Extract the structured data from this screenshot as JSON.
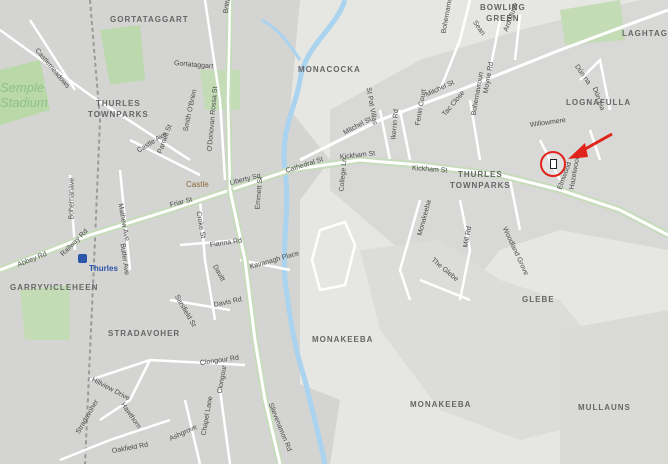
{
  "areas": {
    "gortataggart": "GORTATAGGART",
    "bowling_green": "BOWLING\nGREEN",
    "laghtagalla": "LAGHTAGA",
    "monacocka": "MONACOCKA",
    "lognafulla": "LOGNAFULLA",
    "thurles_townparks_w": "THURLES\nTOWNPARKS",
    "thurles_townparks_e": "THURLES\nTOWNPARKS",
    "garryvicleheen": "GARRYVICLEHEEN",
    "glebe": "GLEBE",
    "stradavoher": "STRADAVOHER",
    "monakeeba_1": "MONAKEEBA",
    "monakeeba_2": "MONAKEEBA",
    "mullauns": "MULLAUNS"
  },
  "places": {
    "semple_stadium": "Semple\nStadium",
    "castle": "Castle",
    "thurles_station": "Thurles"
  },
  "roads": {
    "gortataggart": "Gortataggart",
    "castlemeadows": "Castlemeadows",
    "brittas": "Brittas",
    "smith_obrien": "Smith O'Brien",
    "o_donovan_rossa": "O'Donovan Rossa St",
    "parnell": "Parnell St",
    "castle_ave": "Castle Ave",
    "bohernanave": "Bohernanave",
    "mathew_ave": "Mathew Ave",
    "liberty_sq": "Liberty Sq",
    "cathedral": "Cathedral St",
    "friar": "Friar St",
    "croke": "Croke St",
    "railway": "Railway Rd",
    "abbey": "Abbey Rd",
    "butler_ave": "Butler Ave",
    "fianna": "Fianna Rd",
    "emmett": "Emmett St",
    "kavanagh": "Kavanagh Place",
    "davitt": "Davitt",
    "sarsfield": "Sarsfield St",
    "davis": "Davis Rd",
    "clongour_rd": "Clongour Rd",
    "clongour": "Clongour",
    "hillview": "Hillview Drive",
    "hawthorn": "Hawthorn",
    "oakfield": "Oakfield Rd",
    "stradavoher": "Stradavoher",
    "ashgrove": "Ashgrove",
    "chapel": "Chapel Lane",
    "sievenamon": "Slievenamon Rd",
    "mitchel_a": "Mitchel St",
    "mitchel_b": "Mitchel St",
    "kickham_a": "Kickham St",
    "kickham_b": "Kickham St",
    "college_ln": "College Ln",
    "bohernamona": "Bohernamona",
    "ard_muire": "Ard Muire",
    "moyne": "Moyne Rd",
    "sean": "Sean",
    "dun_na": "Dún na",
    "dun_lia": "Dún Lia",
    "willowmere": "Willowmere",
    "elmwood": "Elmwood",
    "hazelwood": "Hazelwood",
    "st_patrick": "St Pat Villas",
    "tac_close": "Tac Close",
    "fenin_court": "Fenin Court",
    "ikerrin": "Ikerrin Rd",
    "monakeeba": "Monakeeba",
    "the_glebe": "The Glebe",
    "mill_rd": "Mill Rd",
    "woodlands": "Woodland Grove",
    "bohernavroun": "Bohernavroun"
  },
  "marker": {
    "icon": "building-marker-icon",
    "color": "#e0241b"
  },
  "arrow": {
    "icon": "red-arrow-icon",
    "color": "#e0241b"
  },
  "colors": {
    "background": "#e6e6e3",
    "built_up": "#d2d2d0",
    "road": "#ffffff",
    "river": "#a9d3ee",
    "main_road": "#cfe8c4",
    "park": "#b9d9a8"
  }
}
